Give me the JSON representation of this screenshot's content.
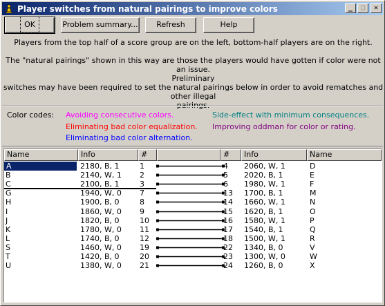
{
  "window": {
    "title": "Player switches from natural pairings to improve colors",
    "controls": {
      "minimize": "_",
      "maximize": "□",
      "close": "✕"
    }
  },
  "toolbar": {
    "ok": "OK",
    "problem_summary": "Problem summary...",
    "refresh": "Refresh",
    "help": "Help"
  },
  "info": {
    "line1": "Players from the top half of a score group are on the left, bottom-half players are on the right.",
    "line2": "The \"natural pairings\" shown in this way are those the players would have gotten if color were not an issue.",
    "line3": "Preliminary",
    "line4": "switches may have been required to set the natural pairings below in order to avoid rematches and other illegal",
    "line5": "pairings."
  },
  "color_codes": {
    "label": "Color codes:",
    "items": [
      {
        "text": "Avoiding consecutive colors.",
        "color": "#ff00ff"
      },
      {
        "text": "Side-effect with minimum consequences.",
        "color": "#008080"
      },
      {
        "text": "Eliminating bad color equalization.",
        "color": "#ff0000"
      },
      {
        "text": "Improving oddman for color or rating.",
        "color": "#800080"
      },
      {
        "text": "Eliminating bad color alternation.",
        "color": "#0000ff"
      }
    ]
  },
  "table": {
    "headers": [
      "Name",
      "Info",
      "#",
      "#",
      "Info",
      "Name"
    ],
    "rows": [
      {
        "lname": "A",
        "linfo": "2180, B, 1",
        "lnum": "1",
        "rnum": "4",
        "rinfo": "2060, W, 1",
        "rname": "D"
      },
      {
        "lname": "B",
        "linfo": "2140, W, 1",
        "lnum": "2",
        "rnum": "5",
        "rinfo": "2020, B, 1",
        "rname": "E"
      },
      {
        "lname": "C",
        "linfo": "2100, B, 1",
        "lnum": "3",
        "rnum": "6",
        "rinfo": "1980, W, 1",
        "rname": "F"
      },
      {
        "lname": "G",
        "linfo": "1940, W, 0",
        "lnum": "7",
        "rnum": "13",
        "rinfo": "1700, B, 1",
        "rname": "M"
      },
      {
        "lname": "H",
        "linfo": "1900, B, 0",
        "lnum": "8",
        "rnum": "14",
        "rinfo": "1660, W, 1",
        "rname": "N"
      },
      {
        "lname": "I",
        "linfo": "1860, W, 0",
        "lnum": "9",
        "rnum": "15",
        "rinfo": "1620, B, 1",
        "rname": "O"
      },
      {
        "lname": "J",
        "linfo": "1820, B, 0",
        "lnum": "10",
        "rnum": "16",
        "rinfo": "1580, W, 1",
        "rname": "P"
      },
      {
        "lname": "K",
        "linfo": "1780, W, 0",
        "lnum": "11",
        "rnum": "17",
        "rinfo": "1540, B, 1",
        "rname": "Q"
      },
      {
        "lname": "L",
        "linfo": "1740, B, 0",
        "lnum": "12",
        "rnum": "18",
        "rinfo": "1500, W, 1",
        "rname": "R"
      },
      {
        "lname": "S",
        "linfo": "1460, W, 0",
        "lnum": "19",
        "rnum": "22",
        "rinfo": "1340, B, 0",
        "rname": "V"
      },
      {
        "lname": "T",
        "linfo": "1420, B, 0",
        "lnum": "20",
        "rnum": "23",
        "rinfo": "1300, W, 0",
        "rname": "W"
      },
      {
        "lname": "U",
        "linfo": "1380, W, 0",
        "lnum": "21",
        "rnum": "24",
        "rinfo": "1260, B, 0",
        "rname": "X"
      }
    ]
  }
}
